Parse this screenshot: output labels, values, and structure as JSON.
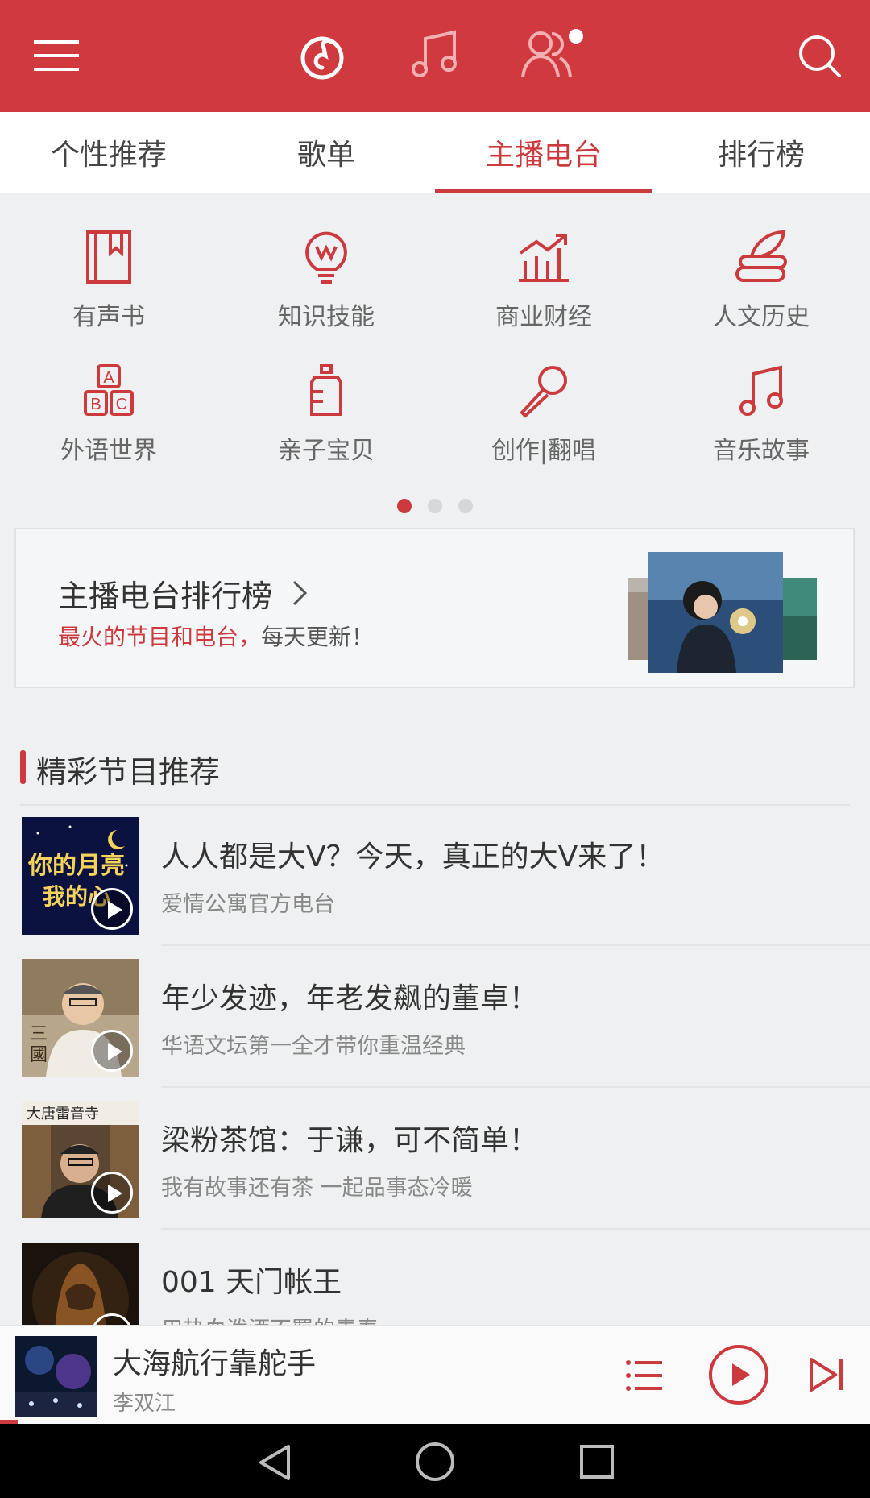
{
  "colors": {
    "brand_red": "#d03a3e",
    "accent": "#cc3a3e"
  },
  "topbar": {
    "icons": [
      "menu-icon",
      "netease-cloud-logo-icon",
      "music-note-icon",
      "friends-icon",
      "search-icon"
    ]
  },
  "tabs": [
    {
      "label": "个性推荐",
      "active": false
    },
    {
      "label": "歌单",
      "active": false
    },
    {
      "label": "主播电台",
      "active": true
    },
    {
      "label": "排行榜",
      "active": false
    }
  ],
  "categories": [
    {
      "label": "有声书",
      "icon": "book-icon"
    },
    {
      "label": "知识技能",
      "icon": "lightbulb-icon"
    },
    {
      "label": "商业财经",
      "icon": "chart-icon"
    },
    {
      "label": "人文历史",
      "icon": "quill-books-icon"
    },
    {
      "label": "外语世界",
      "icon": "abc-blocks-icon"
    },
    {
      "label": "亲子宝贝",
      "icon": "baby-bottle-icon"
    },
    {
      "label": "创作|翻唱",
      "icon": "microphone-icon"
    },
    {
      "label": "音乐故事",
      "icon": "music-note-icon"
    }
  ],
  "pager": {
    "pages": 3,
    "current": 1
  },
  "rank_banner": {
    "title": "主播电台排行榜",
    "subtitle_highlight": "最火的节目和电台，",
    "subtitle_rest": "每天更新！"
  },
  "section": {
    "title": "精彩节目推荐"
  },
  "programs": [
    {
      "title": "人人都是大V？今天，真正的大V来了！",
      "subtitle": "爱情公寓官方电台",
      "thumb_text": "你的月亮 我的心"
    },
    {
      "title": "年少发迹，年老发飙的董卓！",
      "subtitle": "华语文坛第一全才带你重温经典",
      "thumb_text": "三国"
    },
    {
      "title": "梁粉茶馆：于谦，可不简单！",
      "subtitle": "我有故事还有茶 一起品事态冷暖",
      "thumb_text": "大唐雷音寺"
    },
    {
      "title": "001  天门帐王",
      "subtitle": "用热血泼洒不羁的青春",
      "thumb_text": ""
    }
  ],
  "player": {
    "title": "大海航行靠舵手",
    "artist": "李双江",
    "progress": 0.02
  }
}
